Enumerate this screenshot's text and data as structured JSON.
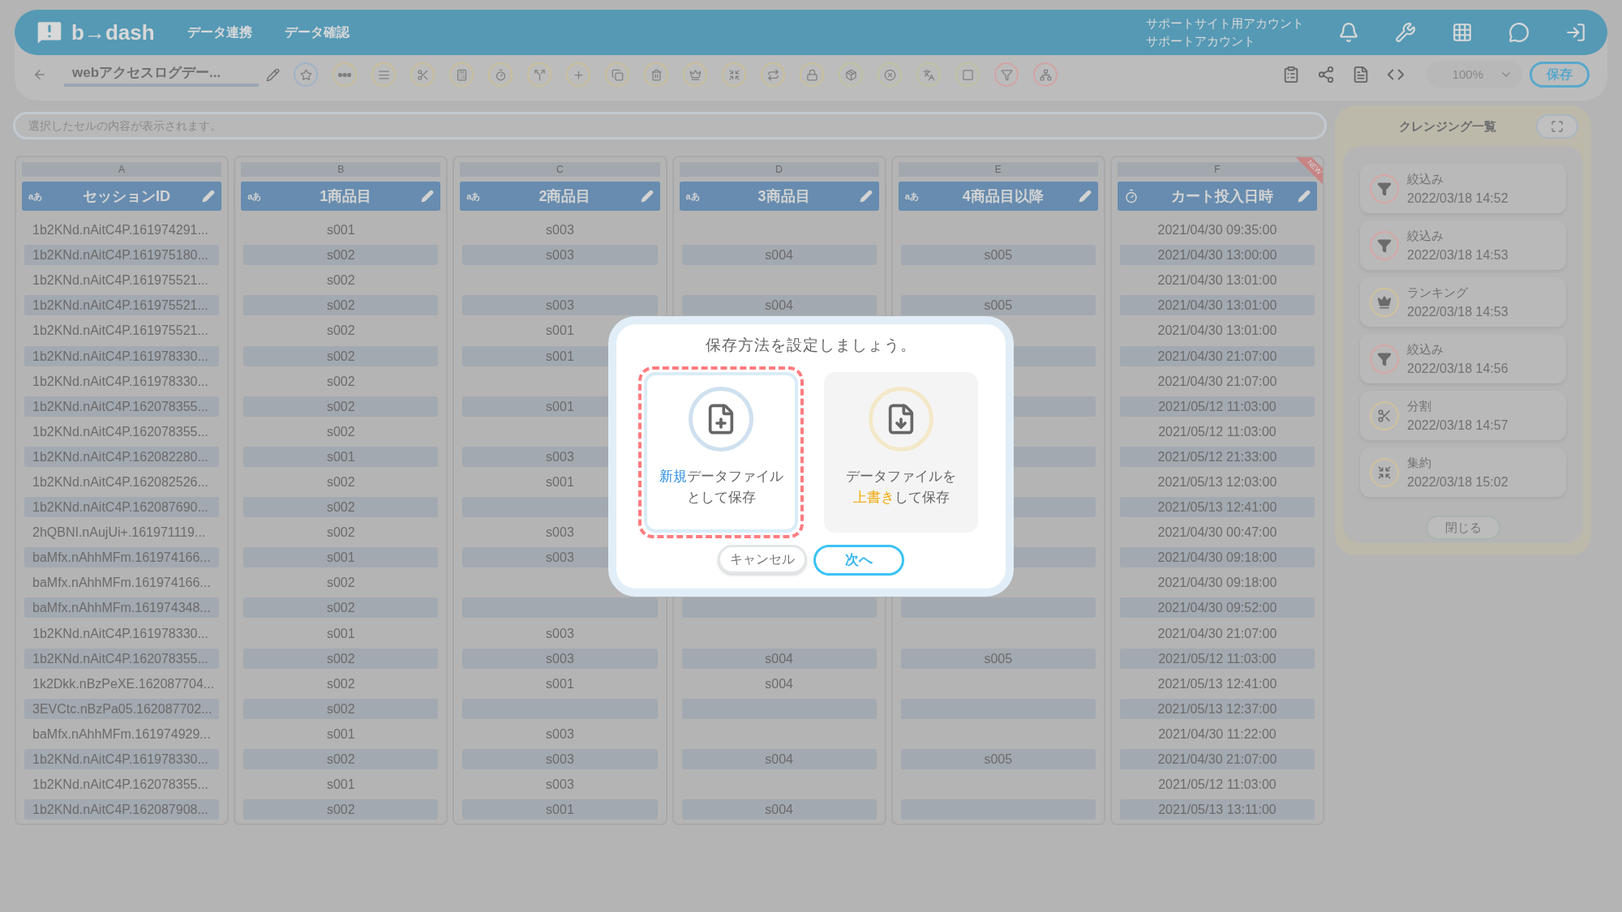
{
  "header": {
    "logo": "b→dash",
    "nav": [
      "データ連携",
      "データ確認"
    ],
    "account": [
      "サポートサイト用アカウント",
      "サポートアカウント"
    ]
  },
  "toolbar": {
    "title": "webアクセスログデー...",
    "zoom": "100%",
    "save": "保存"
  },
  "cell_preview": {
    "placeholder": "選択したセルの内容が表示されます。"
  },
  "table": {
    "columns": [
      {
        "letter": "A",
        "name": "セッションID",
        "kind": "text",
        "type_label": "aあ"
      },
      {
        "letter": "B",
        "name": "1商品目",
        "kind": "text",
        "type_label": "aあ"
      },
      {
        "letter": "C",
        "name": "2商品目",
        "kind": "text",
        "type_label": "aあ"
      },
      {
        "letter": "D",
        "name": "3商品目",
        "kind": "text",
        "type_label": "aあ"
      },
      {
        "letter": "E",
        "name": "4商品目以降",
        "kind": "text",
        "type_label": "aあ"
      },
      {
        "letter": "F",
        "name": "カート投入日時",
        "kind": "datetime",
        "badge": "NEW"
      }
    ],
    "rows": [
      [
        "1b2KNd.nAitC4P.161974291...",
        "s001",
        "s003",
        null,
        null,
        "2021/04/30 09:35:00"
      ],
      [
        "1b2KNd.nAitC4P.161975180...",
        "s002",
        "s003",
        "s004",
        "s005",
        "2021/04/30 13:00:00"
      ],
      [
        "1b2KNd.nAitC4P.161975521...",
        "s002",
        null,
        null,
        null,
        "2021/04/30 13:01:00"
      ],
      [
        "1b2KNd.nAitC4P.161975521...",
        "s002",
        "s003",
        "s004",
        "s005",
        "2021/04/30 13:01:00"
      ],
      [
        "1b2KNd.nAitC4P.161975521...",
        "s002",
        "s001",
        null,
        null,
        "2021/04/30 13:01:00"
      ],
      [
        "1b2KNd.nAitC4P.161978330...",
        "s002",
        "s001",
        null,
        null,
        "2021/04/30 21:07:00"
      ],
      [
        "1b2KNd.nAitC4P.161978330...",
        "s002",
        null,
        null,
        null,
        "2021/04/30 21:07:00"
      ],
      [
        "1b2KNd.nAitC4P.162078355...",
        "s002",
        "s001",
        null,
        null,
        "2021/05/12 11:03:00"
      ],
      [
        "1b2KNd.nAitC4P.162078355...",
        "s002",
        null,
        null,
        null,
        "2021/05/12 11:03:00"
      ],
      [
        "1b2KNd.nAitC4P.162082280...",
        "s001",
        "s003",
        null,
        null,
        "2021/05/12 21:33:00"
      ],
      [
        "1b2KNd.nAitC4P.162082526...",
        "s002",
        "s001",
        null,
        null,
        "2021/05/13 12:03:00"
      ],
      [
        "1b2KNd.nAitC4P.162087690...",
        "s002",
        null,
        null,
        null,
        "2021/05/13 12:41:00"
      ],
      [
        "2hQBNI.nAujUi+.161971119...",
        "s002",
        "s003",
        null,
        null,
        "2021/04/30 00:47:00"
      ],
      [
        "baMfx.nAhhMFm.161974166...",
        "s001",
        "s003",
        null,
        null,
        "2021/04/30 09:18:00"
      ],
      [
        "baMfx.nAhhMFm.161974166...",
        "s002",
        null,
        null,
        null,
        "2021/04/30 09:18:00"
      ],
      [
        "baMfx.nAhhMFm.161974348...",
        "s002",
        null,
        null,
        null,
        "2021/04/30 09:52:00"
      ],
      [
        "1b2KNd.nAitC4P.161978330...",
        "s001",
        "s003",
        null,
        null,
        "2021/04/30 21:07:00"
      ],
      [
        "1b2KNd.nAitC4P.162078355...",
        "s002",
        "s003",
        "s004",
        "s005",
        "2021/05/12 11:03:00"
      ],
      [
        "1k2Dkk.nBzPeXE.162087704...",
        "s002",
        "s001",
        "s004",
        null,
        "2021/05/13 12:41:00"
      ],
      [
        "3EVCtc.nBzPa05.162087702...",
        "s002",
        null,
        null,
        null,
        "2021/05/13 12:37:00"
      ],
      [
        "baMfx.nAhhMFm.161974929...",
        "s001",
        "s003",
        null,
        null,
        "2021/04/30 11:22:00"
      ],
      [
        "1b2KNd.nAitC4P.161978330...",
        "s002",
        "s003",
        "s004",
        "s005",
        "2021/04/30 21:07:00"
      ],
      [
        "1b2KNd.nAitC4P.162078355...",
        "s001",
        "s003",
        null,
        null,
        "2021/05/12 11:03:00"
      ],
      [
        "1b2KNd.nAitC4P.162087908...",
        "s002",
        "s001",
        "s004",
        null,
        "2021/05/13 13:11:00"
      ]
    ]
  },
  "cleansing_panel": {
    "title": "クレンジング一覧",
    "items": [
      {
        "kind": "filter",
        "label": "絞込み",
        "time": "2022/03/18 14:52"
      },
      {
        "kind": "filter",
        "label": "絞込み",
        "time": "2022/03/18 14:53"
      },
      {
        "kind": "ranking",
        "label": "ランキング",
        "time": "2022/03/18 14:53"
      },
      {
        "kind": "filter",
        "label": "絞込み",
        "time": "2022/03/18 14:56"
      },
      {
        "kind": "split",
        "label": "分割",
        "time": "2022/03/18 14:57"
      },
      {
        "kind": "aggregate",
        "label": "集約",
        "time": "2022/03/18 15:02"
      }
    ],
    "close": "閉じる"
  },
  "dialog": {
    "title": "保存方法を設定しましょう。",
    "options": [
      {
        "kind": "new",
        "lines": [
          "**新規**データファイル",
          "として保存"
        ],
        "color": "#2b8ee6",
        "selected": true
      },
      {
        "kind": "overwrite",
        "lines": [
          "データファイルを",
          "**上書き**して保存"
        ],
        "color": "#f0a800",
        "selected": false
      }
    ],
    "buttons": [
      {
        "kind": "cancel",
        "label": "キャンセル"
      },
      {
        "kind": "next",
        "label": "次へ"
      }
    ]
  }
}
